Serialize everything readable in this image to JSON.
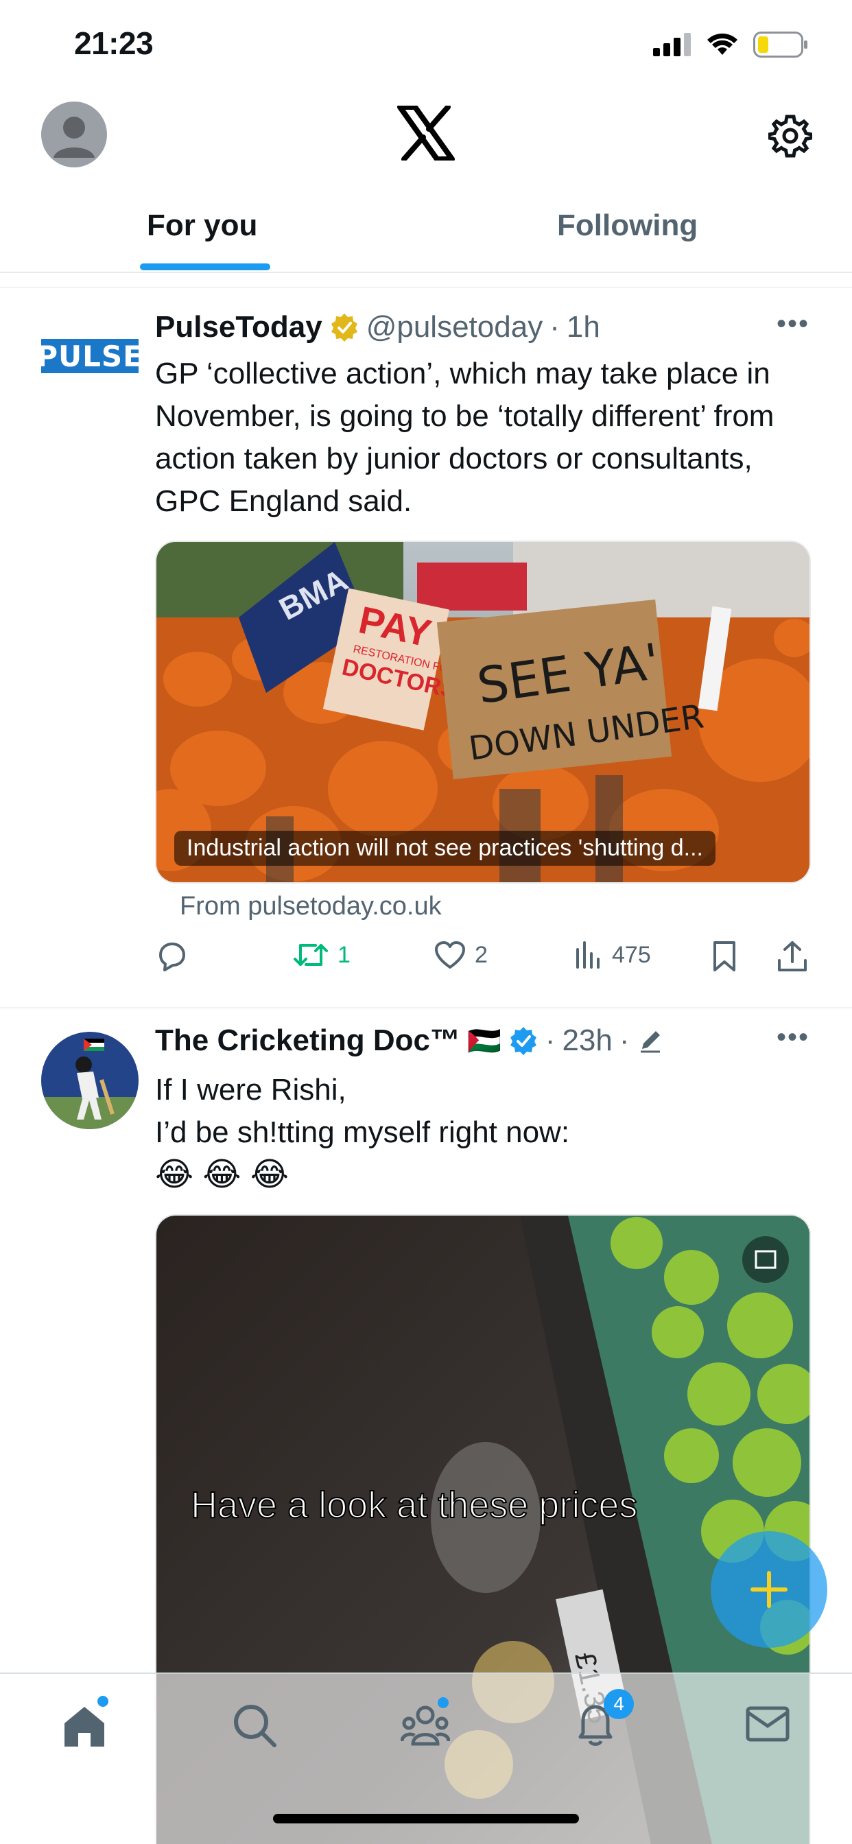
{
  "status_bar": {
    "time": "21:23"
  },
  "top_nav": {
    "logo": "X"
  },
  "tabs": [
    {
      "label": "For you"
    },
    {
      "label": "Following"
    }
  ],
  "posts": [
    {
      "name": "PulseToday",
      "handle": "@pulsetoday",
      "time": "1h",
      "avatar_text": "PULSE",
      "text": "GP ‘collective action’, which may take place in November, is going to be ‘totally different’ from action taken by junior doctors or consultants, GPC England said.",
      "media_caption": "Industrial action will not see practices 'shutting d...",
      "media_signs": {
        "pay": "PAY",
        "pay_sub": "RESTORATION FOR",
        "doctors": "DOCTORS",
        "bma": "BMA",
        "see_ya": "SEE YA'",
        "down_under": "DOWN UNDER"
      },
      "link_source": "From pulsetoday.co.uk",
      "stats": {
        "replies": "",
        "reposts": "1",
        "likes": "2",
        "views": "475"
      }
    },
    {
      "name": "The Cricketing Doc™",
      "flag": "🇵🇸",
      "time": "23h",
      "text_lines": [
        "If I were Rishi,",
        "I’d be sh!tting myself right now:",
        "😂 😂 😂"
      ],
      "media_overlay": "Have a look at these prices",
      "media_price": "£1.35"
    }
  ],
  "bottom_nav": {
    "notifications_badge": "4"
  },
  "colors": {
    "accent": "#1d9bf0",
    "text": "#0f1419",
    "muted": "#536471",
    "repost": "#00ba7c",
    "verified_gold": "#e2b719"
  }
}
